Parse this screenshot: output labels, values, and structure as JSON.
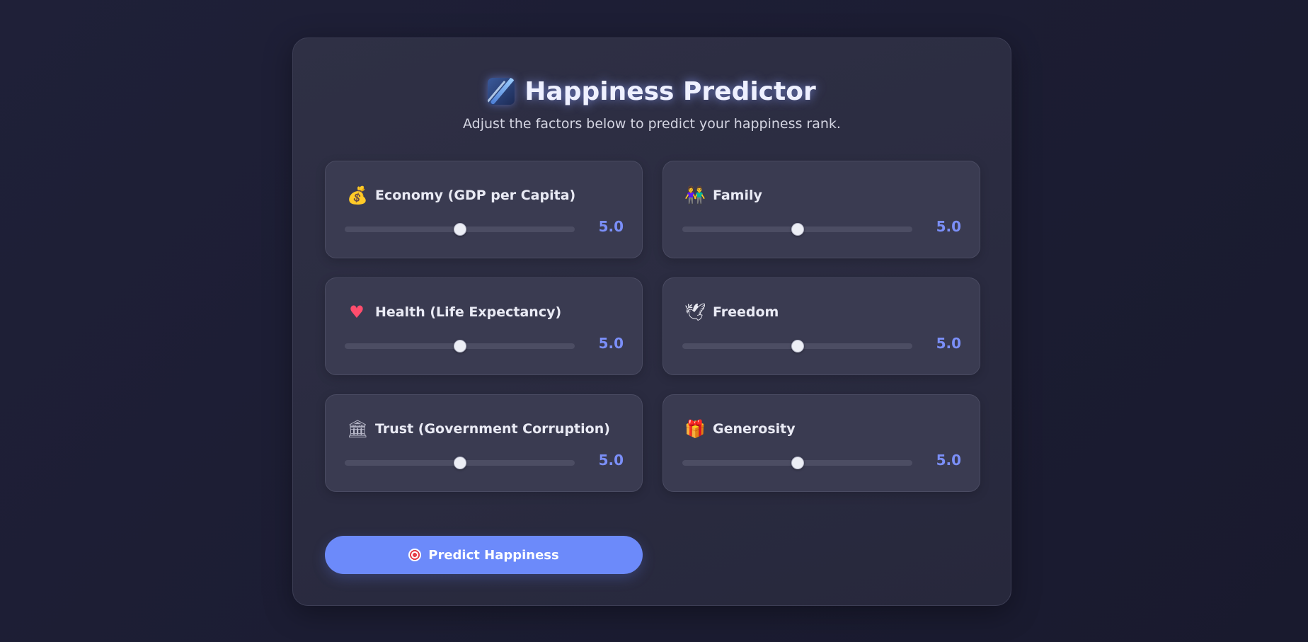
{
  "header": {
    "title": "Happiness Predictor",
    "subtitle": "Adjust the factors below to predict your happiness rank.",
    "title_icon": "shooting-star-icon"
  },
  "factors": [
    {
      "label": "Economy (GDP per Capita)",
      "icon": "money-bag-icon",
      "value": "5.0",
      "level": 0.5
    },
    {
      "label": "Family",
      "icon": "family-icon",
      "value": "5.0",
      "level": 0.5
    },
    {
      "label": "Health (Life Expectancy)",
      "icon": "heart-icon",
      "value": "5.0",
      "level": 0.5
    },
    {
      "label": "Freedom",
      "icon": "dove-icon",
      "value": "5.0",
      "level": 0.5
    },
    {
      "label": "Trust (Government Corruption)",
      "icon": "bank-icon",
      "value": "5.0",
      "level": 0.5
    },
    {
      "label": "Generosity",
      "icon": "gift-icon",
      "value": "5.0",
      "level": 0.5
    }
  ],
  "action": {
    "predict_label": "Predict Happiness",
    "predict_icon": "target-icon"
  },
  "colors": {
    "accent": "#6c8afa",
    "value_text": "#7b8ff8",
    "card_bg": "#2c2d42",
    "factor_bg": "#3a3b51"
  }
}
